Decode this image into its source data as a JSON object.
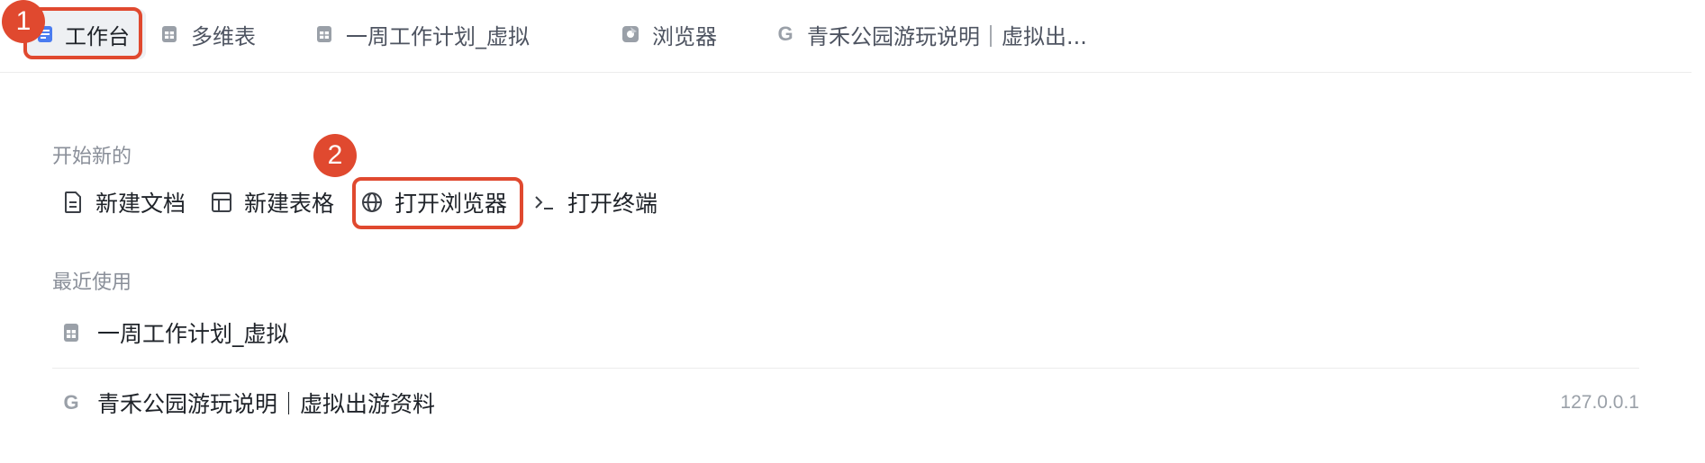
{
  "tabs": [
    {
      "label": "工作台",
      "icon": "workbench-icon",
      "active": true
    },
    {
      "label": "多维表",
      "icon": "table-icon",
      "active": false
    },
    {
      "label": "一周工作计划_虚拟",
      "icon": "table-icon",
      "active": false
    },
    {
      "label": "浏览器",
      "icon": "browser-icon",
      "active": false
    },
    {
      "label": "青禾公园游玩说明｜虚拟出...",
      "icon": "google-icon",
      "active": false
    }
  ],
  "start_new": {
    "title": "开始新的",
    "actions": [
      {
        "label": "新建文档",
        "icon": "document-icon"
      },
      {
        "label": "新建表格",
        "icon": "grid-icon"
      },
      {
        "label": "打开浏览器",
        "icon": "globe-icon"
      },
      {
        "label": "打开终端",
        "icon": "terminal-icon"
      }
    ]
  },
  "recent": {
    "title": "最近使用",
    "items": [
      {
        "title": "一周工作计划_虚拟",
        "icon": "table-icon",
        "meta": ""
      },
      {
        "title": "青禾公园游玩说明｜虚拟出游资料",
        "icon": "google-icon",
        "meta": "127.0.0.1"
      }
    ]
  },
  "annotations": {
    "step1": "1",
    "step2": "2"
  },
  "colors": {
    "highlight": "#e0492f",
    "active_tab_bg": "#eef0f3"
  }
}
